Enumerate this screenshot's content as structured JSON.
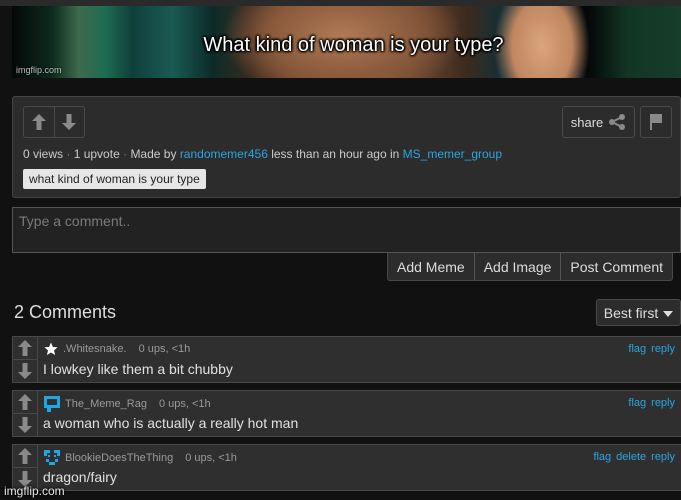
{
  "meme": {
    "caption": "What kind of woman is your type?",
    "watermark": "imgflip.com"
  },
  "post": {
    "views": "0 views",
    "upvotes": "1 upvote",
    "made_by_label": "Made by",
    "author": "randomemer456",
    "time_label": "less than an hour ago in",
    "stream": "MS_memer_group",
    "separator": "·",
    "tag": "what kind of woman is your type",
    "share_label": "share"
  },
  "comment_form": {
    "placeholder": "Type a comment..",
    "buttons": [
      "Add Meme",
      "Add Image",
      "Post Comment"
    ]
  },
  "comments_header": {
    "title": "2 Comments",
    "sort_selected": "Best first"
  },
  "comments": [
    {
      "user": ".Whitesnake.",
      "avatar": "star-icon",
      "stats": "0 ups, <1h",
      "text": "I lowkey like them a bit chubby",
      "actions": [
        "flag",
        "reply"
      ]
    },
    {
      "user": "The_Meme_Rag",
      "avatar": "speech-bubble-avatar",
      "stats": "0 ups, <1h",
      "text": "a woman who is actually a really hot man",
      "actions": [
        "flag",
        "reply"
      ]
    },
    {
      "user": "BlookieDoesTheThing",
      "avatar": "pixel-face-avatar",
      "stats": "0 ups, <1h",
      "text": "dragon/fairy",
      "actions": [
        "flag",
        "delete",
        "reply"
      ]
    }
  ],
  "footer_watermark": "imgflip.com",
  "colors": {
    "link": "#2aa6e0",
    "avatar_blue": "#1ea7e4",
    "background": "#111111",
    "panel": "#2c2c2c"
  }
}
